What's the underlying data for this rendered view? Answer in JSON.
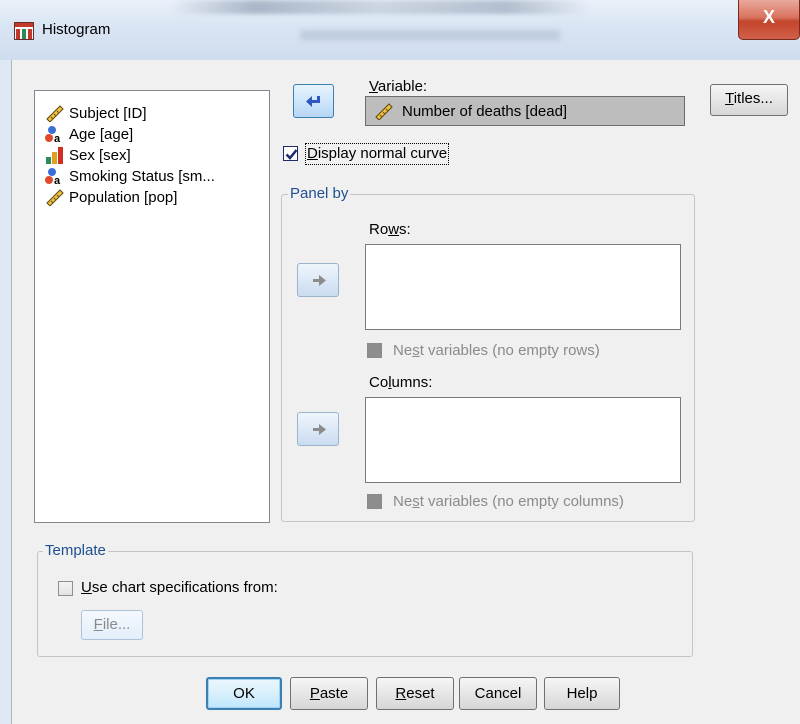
{
  "window": {
    "title": "Histogram",
    "close_glyph": "X"
  },
  "variables": [
    {
      "label": "Subject [ID]",
      "icon": "scale-ruler-icon"
    },
    {
      "label": "Age [age]",
      "icon": "nominal-icon"
    },
    {
      "label": "Sex [sex]",
      "icon": "ordinal-bars-icon"
    },
    {
      "label": "Smoking Status [sm...",
      "icon": "nominal-icon"
    },
    {
      "label": "Population [pop]",
      "icon": "scale-ruler-icon"
    }
  ],
  "variable_field": {
    "label_mn": "V",
    "label_rest": "ariable:",
    "value": "Number of deaths [dead]"
  },
  "display_normal_curve": {
    "mn": "D",
    "rest": "isplay normal curve",
    "checked": true
  },
  "panel_by": {
    "title": "Panel by",
    "rows_label_pre": "Ro",
    "rows_label_mn": "w",
    "rows_label_post": "s:",
    "nest_rows_pre": "Ne",
    "nest_rows_mn": "s",
    "nest_rows_post": "t variables (no empty rows)",
    "columns_label_pre": "Co",
    "columns_label_mn": "l",
    "columns_label_post": "umns:",
    "nest_cols_pre": "Ne",
    "nest_cols_mn": "s",
    "nest_cols_post": "t variables (no empty columns)"
  },
  "template": {
    "title": "Template",
    "use_chart_mn": "U",
    "use_chart_rest": "se chart specifications from:",
    "file_mn": "F",
    "file_rest": "ile..."
  },
  "titles_button": {
    "mn": "T",
    "rest": "itles..."
  },
  "buttons": {
    "ok": "OK",
    "paste_mn": "P",
    "paste_rest": "aste",
    "reset_mn": "R",
    "reset_rest": "eset",
    "cancel": "Cancel",
    "help": "Help"
  },
  "colors": {
    "accent": "#3c7fb1",
    "group_title": "#1f4f91",
    "close": "#c3442b"
  }
}
